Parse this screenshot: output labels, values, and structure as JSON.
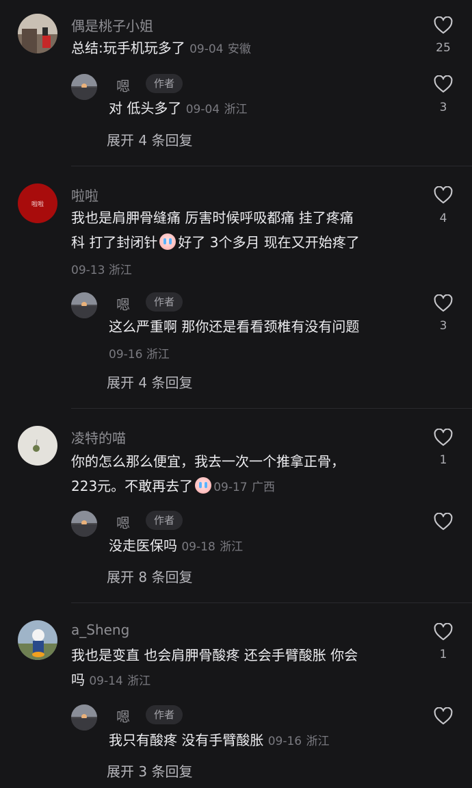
{
  "comments": [
    {
      "username": "偶是桃子小姐",
      "text": "总结:玩手机玩多了",
      "date": "09-04",
      "location": "安徽",
      "likes": "25",
      "reply": {
        "name": "嗯",
        "tag": "作者",
        "text": "对 低头多了",
        "date": "09-04",
        "location": "浙江",
        "likes": "3"
      },
      "expand": "展开 4 条回复"
    },
    {
      "username": "啦啦",
      "text_line1": "我也是肩胛骨缝痛  厉害时候呼吸都痛  挂了疼痛",
      "text_line2a": "科 打了封闭针",
      "text_line2b": "好了 3个多月 现在又开始疼了",
      "date": "09-13",
      "location": "浙江",
      "likes": "4",
      "avatar_text": "啦啦",
      "reply": {
        "name": "嗯",
        "tag": "作者",
        "text": "这么严重啊 那你还是看看颈椎有没有问题",
        "date": "09-16",
        "location": "浙江",
        "likes": "3"
      },
      "expand": "展开 4 条回复"
    },
    {
      "username": "凌特的喵",
      "text_line1": "你的怎么那么便宜，我去一次一个推拿正骨，",
      "text_line2": "223元。不敢再去了",
      "date": "09-17",
      "location": "广西",
      "likes": "1",
      "reply": {
        "name": "嗯",
        "tag": "作者",
        "text": "没走医保吗",
        "date": "09-18",
        "location": "浙江",
        "likes": ""
      },
      "expand": "展开 8 条回复"
    },
    {
      "username": "a_Sheng",
      "text_line1": "我也是变直  也会肩胛骨酸疼  还会手臂酸胀  你会",
      "text_line2": "吗",
      "date": "09-14",
      "location": "浙江",
      "likes": "1",
      "reply": {
        "name": "嗯",
        "tag": "作者",
        "text": "我只有酸疼 没有手臂酸胀",
        "date": "09-16",
        "location": "浙江",
        "likes": ""
      },
      "expand": "展开 3 条回复"
    }
  ],
  "icons": {
    "like": "heart-outline-icon",
    "emoji": "crying-face-emoji"
  },
  "colors": {
    "background": "#161618",
    "text": "#ececef",
    "secondary": "#8e8e93"
  }
}
